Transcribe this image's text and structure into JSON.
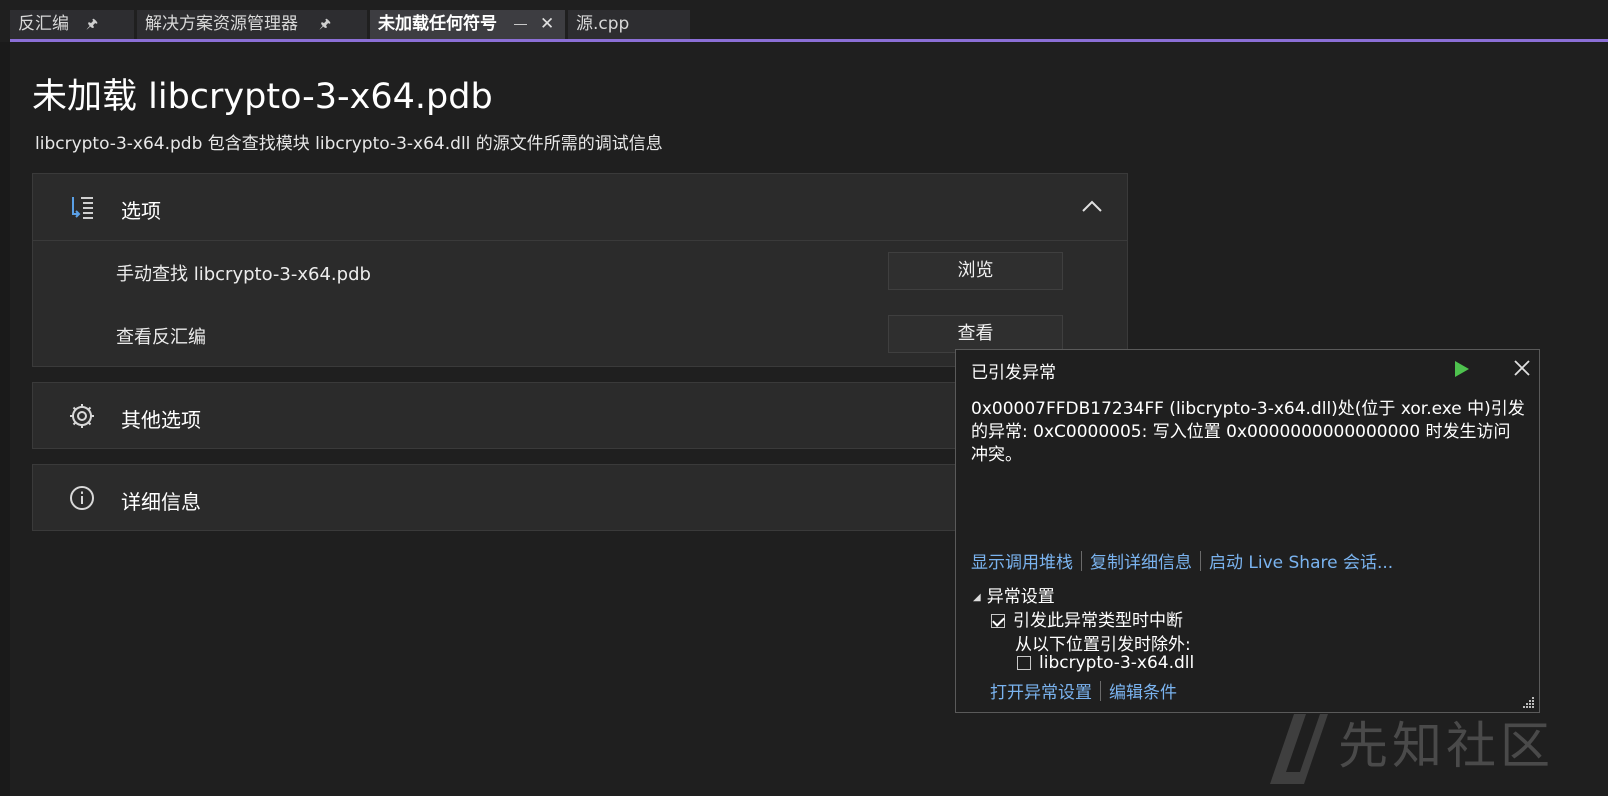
{
  "tabs": [
    {
      "label": "反汇编",
      "pin_icon": "pin-icon"
    },
    {
      "label": "解决方案资源管理器",
      "pin_icon": "pin-icon"
    },
    {
      "label": "未加载任何符号",
      "pin_icon": "pin-icon",
      "active": true
    },
    {
      "label": "源.cpp"
    }
  ],
  "page": {
    "title": "未加载 libcrypto-3-x64.pdb",
    "description": "libcrypto-3-x64.pdb 包含查找模块 libcrypto-3-x64.dll 的源文件所需的调试信息"
  },
  "sections": {
    "options": {
      "label": "选项",
      "rows": [
        {
          "label": "手动查找 libcrypto-3-x64.pdb",
          "button": "浏览"
        },
        {
          "label": "查看反汇编",
          "button": "查看"
        }
      ]
    },
    "other": {
      "label": "其他选项"
    },
    "details": {
      "label": "详细信息"
    }
  },
  "exception": {
    "title": "已引发异常",
    "message": "0x00007FFDB17234FF (libcrypto-3-x64.dll)处(位于 xor.exe 中)引发的异常: 0xC0000005: 写入位置 0x0000000000000000 时发生访问冲突。",
    "links": [
      "显示调用堆栈",
      "复制详细信息",
      "启动 Live Share 会话..."
    ],
    "settings_header": "异常设置",
    "break_label": "引发此异常类型时中断",
    "break_checked": true,
    "except_label": "从以下位置引发时除外:",
    "module_label": "libcrypto-3-x64.dll",
    "module_checked": false,
    "bottom_links": [
      "打开异常设置",
      "编辑条件"
    ]
  },
  "watermark": {
    "text": "先知社区"
  },
  "colors": {
    "accent": "#8b6fd6",
    "link": "#7ab3ef",
    "play": "#4ec24e"
  }
}
